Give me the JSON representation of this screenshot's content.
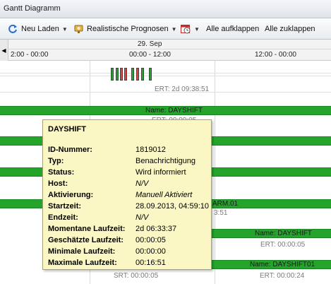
{
  "window": {
    "title": "Gantt Diagramm"
  },
  "toolbar": {
    "reload_label": "Neu Laden",
    "forecast_label": "Realistische Prognosen",
    "expand_all_label": "Alle aufklappen",
    "collapse_all_label": "Alle zuklappen"
  },
  "timeline": {
    "date": "29. Sep",
    "times": [
      "2:00 - 00:00",
      "00:00 - 12:00",
      "12:00 - 00:00"
    ]
  },
  "bars": [
    {
      "label": "",
      "ert": "ERT: 2d 09:38:51"
    },
    {
      "label": "Name: DAYSHIFT",
      "ert": "ERT: 00:00:05"
    },
    {
      "label": "ARM.01",
      "ert": "3:51"
    },
    {
      "label": "Name: DAYSHIFT",
      "ert": "ERT: 00:00:05"
    },
    {
      "label": "Name: DAYSHIFT01",
      "ert": "ERT: 00:00:24"
    },
    {
      "label": "",
      "ert": "SRT: 00:00:05"
    }
  ],
  "tooltip": {
    "title": "DAYSHIFT",
    "rows": [
      {
        "key": "ID-Nummer:",
        "value": "1819012"
      },
      {
        "key": "Typ:",
        "value": "Benachrichtigung"
      },
      {
        "key": "Status:",
        "value": "Wird informiert"
      },
      {
        "key": "Host:",
        "value": "N/V"
      },
      {
        "key": "Aktivierung:",
        "value": "Manuell Aktiviert"
      },
      {
        "key": "Startzeit:",
        "value": "28.09.2013, 04:59:10"
      },
      {
        "key": "Endzeit:",
        "value": "N/V"
      },
      {
        "key": "Momentane Laufzeit:",
        "value": "2d 06:33:37"
      },
      {
        "key": "Geschätzte Laufzeit:",
        "value": "00:00:05"
      },
      {
        "key": "Minimale Laufzeit:",
        "value": "00:00:00"
      },
      {
        "key": "Maximale Laufzeit:",
        "value": "00:16:51"
      }
    ]
  },
  "colors": {
    "bar_green": "#25a42c",
    "tooltip_bg": "#fbf7c4",
    "mini_red": "#e04040"
  },
  "icons": [
    "reload-icon",
    "forecast-icon",
    "calendar-clock-icon",
    "scroll-left-icon"
  ]
}
